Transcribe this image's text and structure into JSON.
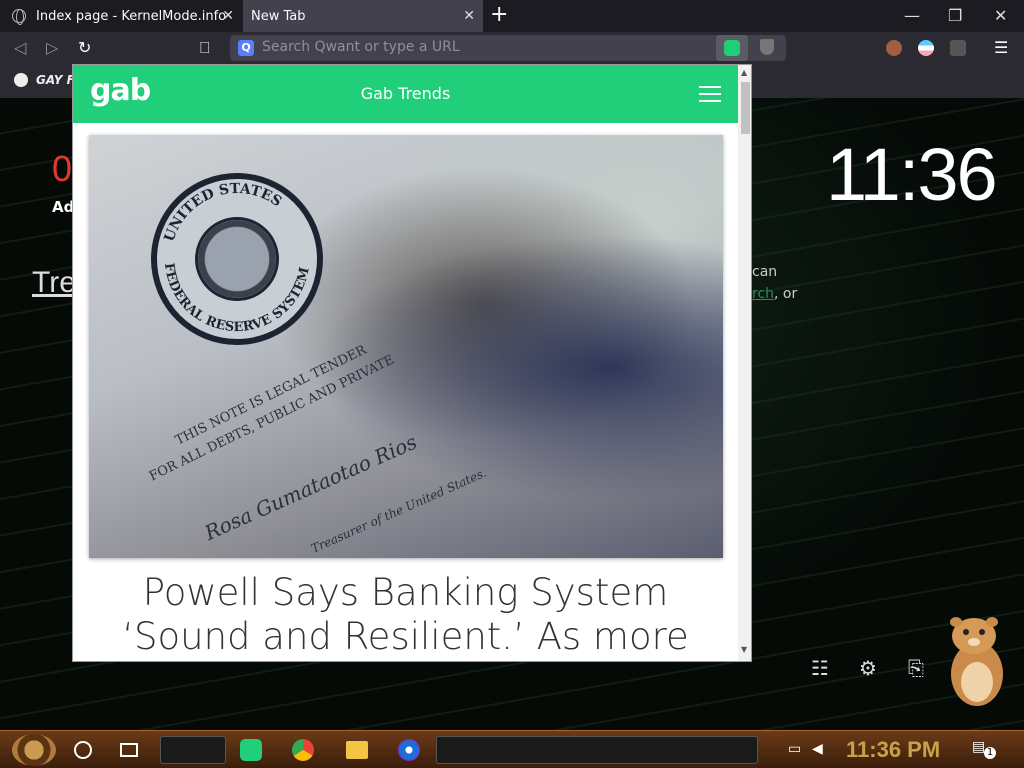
{
  "browser": {
    "tabs": [
      {
        "title": "Index page - KernelMode.info",
        "close": "✕"
      },
      {
        "title": "New Tab",
        "close": "✕"
      }
    ],
    "new_tab": "+",
    "window": {
      "minimize": "—",
      "restore": "❐",
      "close": "✕"
    },
    "nav": {
      "back": "◁",
      "forward": "▷",
      "reload": "↻",
      "bookmark": "⎕"
    },
    "search_placeholder": "Search Qwant or type a URL",
    "search_engine_letter": "Q",
    "menu": "☰",
    "bookmarks": [
      {
        "label": "GAY F"
      }
    ]
  },
  "newtab_page": {
    "red_fragment": "0",
    "ad_fragment": "Ad",
    "trending_fragment": "Tre",
    "clock": "11:36",
    "side_text_1": "can",
    "side_text_2_link": "rch",
    "side_text_2_rest": ", or",
    "tools": {
      "sliders": "☷",
      "settings": "⚙",
      "bookmarks": "⎘"
    }
  },
  "gab_popup": {
    "logo": "gab",
    "title": "Gab Trends",
    "article_headline": "Powell Says Banking System ‘Sound and Resilient.’ As more banks are on",
    "image_text": {
      "seal_top": "UNITED STATES",
      "seal_bottom": "FEDERAL RESERVE SYSTEM",
      "legal_tender": "THIS NOTE IS LEGAL TENDER",
      "debts": "FOR ALL DEBTS, PUBLIC AND PRIVATE",
      "signature": "Rosa Gumataotao Rios",
      "treasurer": "Treasurer of the United States."
    }
  },
  "taskbar": {
    "clock": "11:36 PM",
    "notification_count": "1"
  },
  "colors": {
    "gab_green": "#21cf7a",
    "taskbar_gold": "#c8a24a",
    "clock_red": "#e03a2a"
  }
}
